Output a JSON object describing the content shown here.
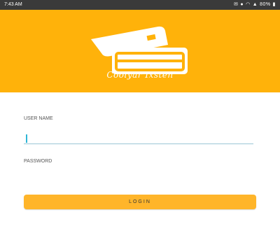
{
  "status_bar": {
    "time": "7:43 AM",
    "icons": [
      "mail-icon",
      "notification-icon",
      "wifi-icon",
      "signal-icon",
      "battery-icon"
    ],
    "battery": "80%"
  },
  "header": {
    "app_name": "Coolyar Ixsten",
    "background_color": "#ffb20a"
  },
  "form": {
    "username_label": "USER NAME",
    "username_value": "",
    "password_label": "PASSWORD",
    "password_value": "",
    "login_label": "LOGIN",
    "accent_color": "#ffb52a"
  }
}
